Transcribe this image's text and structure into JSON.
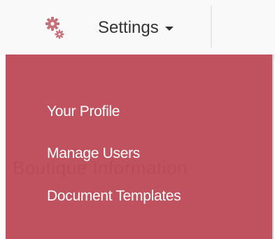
{
  "header": {
    "settings_label": "Settings",
    "settings_icon": "gears-icon",
    "caret_icon": "caret-down-icon"
  },
  "dropdown": {
    "items": [
      {
        "label": "Your Profile"
      },
      {
        "label": "Manage Users"
      },
      {
        "label": "Document Templates"
      }
    ],
    "background_text": "Boutique Information"
  },
  "colors": {
    "dropdown_bg": "#c0525f",
    "gear_color": "#c7707a",
    "text_white": "#ffffff",
    "text_dark": "#333333"
  }
}
